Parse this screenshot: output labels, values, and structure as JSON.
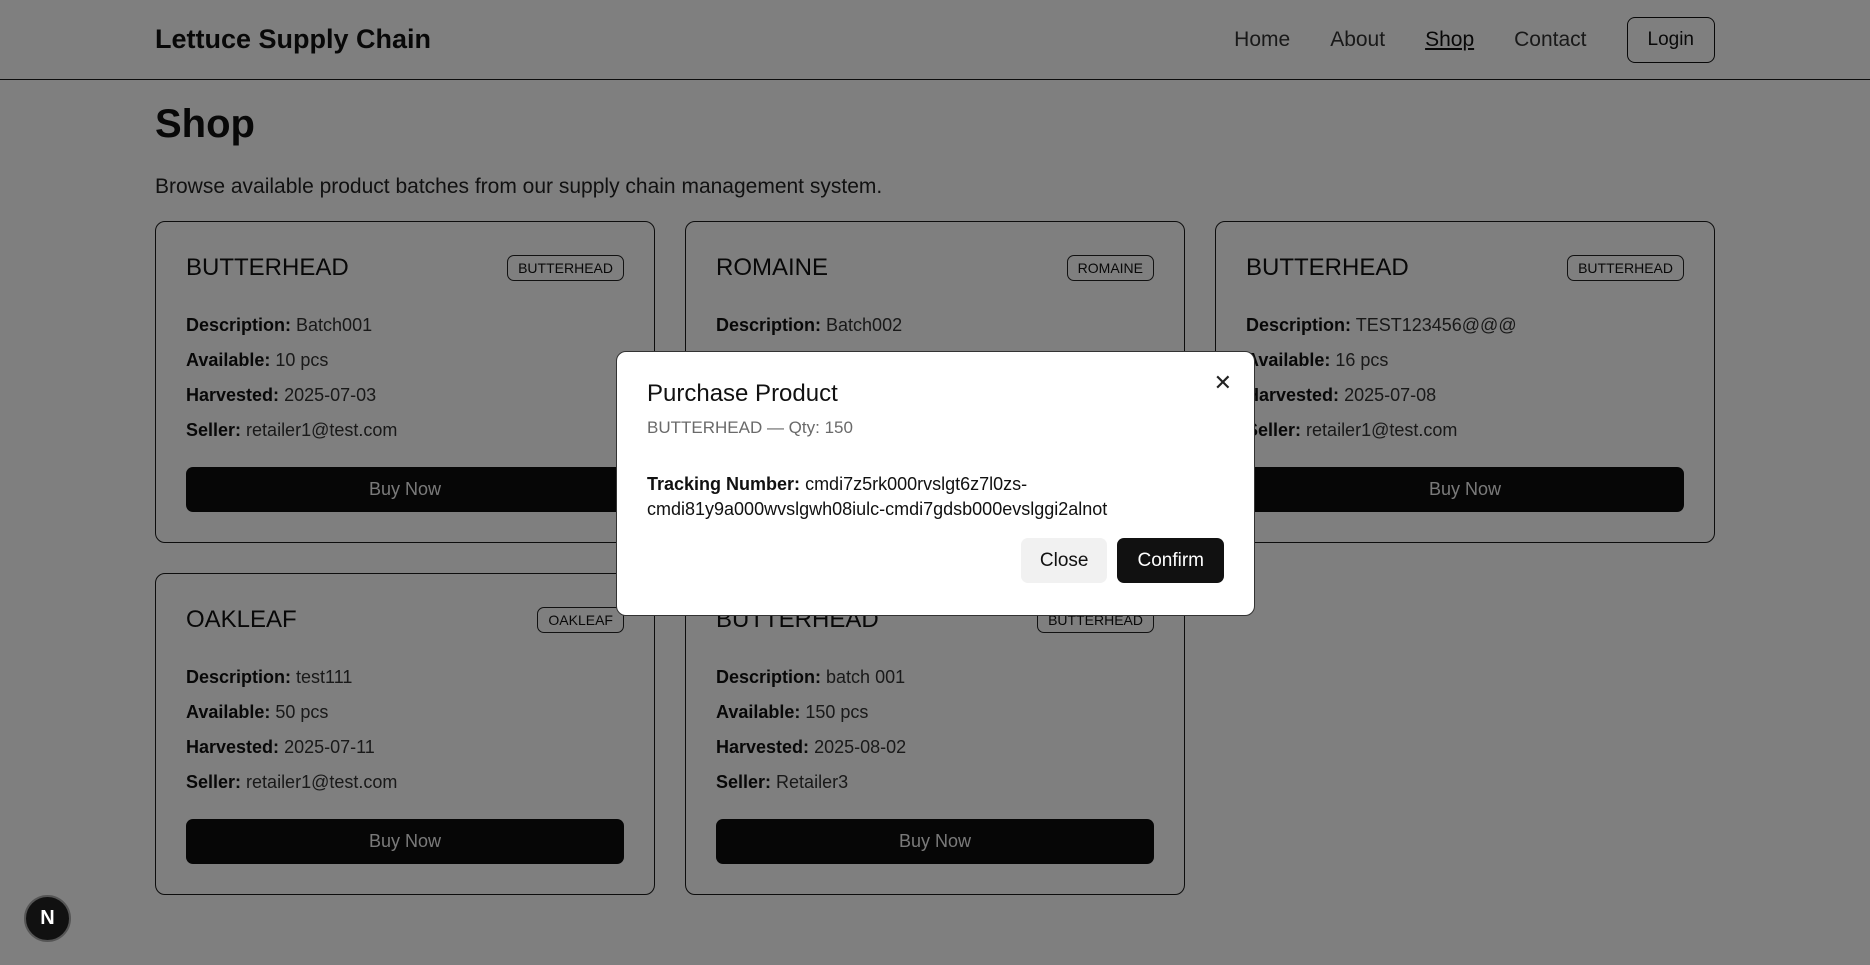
{
  "nav": {
    "brand": "Lettuce Supply Chain",
    "links": [
      "Home",
      "About",
      "Shop",
      "Contact"
    ],
    "login_label": "Login"
  },
  "page": {
    "title": "Shop",
    "subtitle": "Browse available product batches from our supply chain management system."
  },
  "labels": {
    "description": "Description:",
    "available": "Available:",
    "harvested": "Harvested:",
    "seller": "Seller:",
    "buy": "Buy Now"
  },
  "cards": [
    {
      "title": "BUTTERHEAD",
      "badge": "BUTTERHEAD",
      "description": "Batch001",
      "available": "10 pcs",
      "harvested": "2025-07-03",
      "seller": "retailer1@test.com"
    },
    {
      "title": "ROMAINE",
      "badge": "ROMAINE",
      "description": "Batch002",
      "available": "",
      "harvested": "",
      "seller": ""
    },
    {
      "title": "BUTTERHEAD",
      "badge": "BUTTERHEAD",
      "description": "TEST123456@@@",
      "available": "16 pcs",
      "harvested": "2025-07-08",
      "seller": "retailer1@test.com"
    },
    {
      "title": "OAKLEAF",
      "badge": "OAKLEAF",
      "description": "test111",
      "available": "50 pcs",
      "harvested": "2025-07-11",
      "seller": "retailer1@test.com"
    },
    {
      "title": "BUTTERHEAD",
      "badge": "BUTTERHEAD",
      "description": "batch 001",
      "available": "150 pcs",
      "harvested": "2025-08-02",
      "seller": "Retailer3"
    }
  ],
  "modal": {
    "title": "Purchase Product",
    "subtitle": "BUTTERHEAD — Qty: 150",
    "tracking_label": "Tracking Number:",
    "tracking_value": "cmdi7z5rk000rvslgt6z7l0zs-cmdi81y9a000wvslgwh08iulc-cmdi7gdsb000evslggi2alnot",
    "close_label": "Close",
    "confirm_label": "Confirm"
  },
  "dev_badge": "N"
}
